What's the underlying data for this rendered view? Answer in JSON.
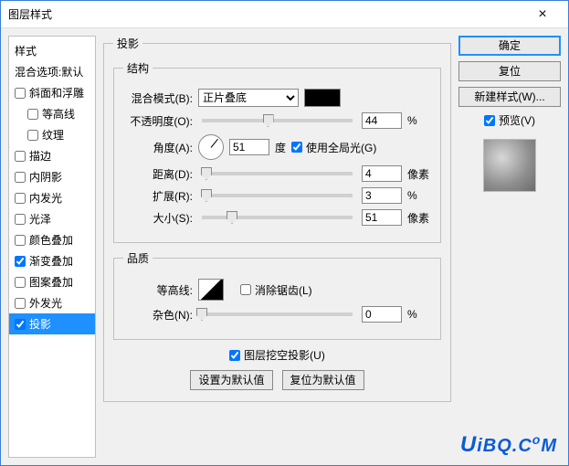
{
  "window": {
    "title": "图层样式",
    "close": "×"
  },
  "sidebar": {
    "styles_header": "样式",
    "blend_header": "混合选项:默认",
    "items": [
      {
        "label": "斜面和浮雕",
        "checked": false,
        "indent": false
      },
      {
        "label": "等高线",
        "checked": false,
        "indent": true
      },
      {
        "label": "纹理",
        "checked": false,
        "indent": true
      },
      {
        "label": "描边",
        "checked": false,
        "indent": false
      },
      {
        "label": "内阴影",
        "checked": false,
        "indent": false
      },
      {
        "label": "内发光",
        "checked": false,
        "indent": false
      },
      {
        "label": "光泽",
        "checked": false,
        "indent": false
      },
      {
        "label": "颜色叠加",
        "checked": false,
        "indent": false
      },
      {
        "label": "渐变叠加",
        "checked": true,
        "indent": false
      },
      {
        "label": "图案叠加",
        "checked": false,
        "indent": false
      },
      {
        "label": "外发光",
        "checked": false,
        "indent": false
      },
      {
        "label": "投影",
        "checked": true,
        "indent": false,
        "selected": true
      }
    ]
  },
  "panel": {
    "title": "投影",
    "structure": {
      "legend": "结构",
      "blend_mode_label": "混合模式(B):",
      "blend_mode_value": "正片叠底",
      "opacity_label": "不透明度(O):",
      "opacity_value": "44",
      "percent": "%",
      "angle_label": "角度(A):",
      "angle_value": "51",
      "degree": "度",
      "global_light_label": "使用全局光(G)",
      "global_light_checked": true,
      "distance_label": "距离(D):",
      "distance_value": "4",
      "px": "像素",
      "spread_label": "扩展(R):",
      "spread_value": "3",
      "size_label": "大小(S):",
      "size_value": "51"
    },
    "quality": {
      "legend": "品质",
      "contour_label": "等高线:",
      "antialias_label": "消除锯齿(L)",
      "antialias_checked": false,
      "noise_label": "杂色(N):",
      "noise_value": "0"
    },
    "knockout_label": "图层挖空投影(U)",
    "knockout_checked": true,
    "set_default": "设置为默认值",
    "reset_default": "复位为默认值"
  },
  "right": {
    "ok": "确定",
    "reset": "复位",
    "new_style": "新建样式(W)...",
    "preview_label": "预览(V)",
    "preview_checked": true
  },
  "watermark": "UiBQ.CoM"
}
